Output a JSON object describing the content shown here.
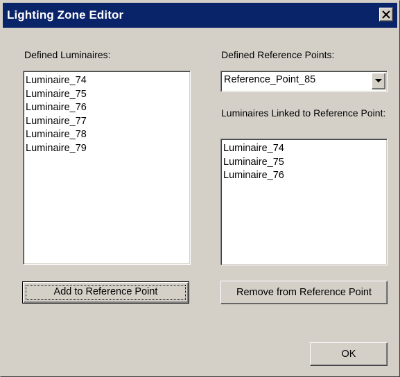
{
  "window": {
    "title": "Lighting Zone Editor",
    "close_label": "×"
  },
  "luminaires": {
    "label": "Defined Luminaires:",
    "items": [
      "Luminaire_74",
      "Luminaire_75",
      "Luminaire_76",
      "Luminaire_77",
      "Luminaire_78",
      "Luminaire_79"
    ]
  },
  "reference_points": {
    "label": "Defined Reference Points:",
    "selected": "Reference_Point_85"
  },
  "linked": {
    "label": "Luminaires Linked to Reference Point:",
    "items": [
      "Luminaire_74",
      "Luminaire_75",
      "Luminaire_76"
    ]
  },
  "buttons": {
    "add": "Add to Reference Point",
    "remove": "Remove from Reference Point",
    "ok": "OK"
  },
  "colors": {
    "titlebar": "#0a246a",
    "face": "#d4d0c8"
  }
}
